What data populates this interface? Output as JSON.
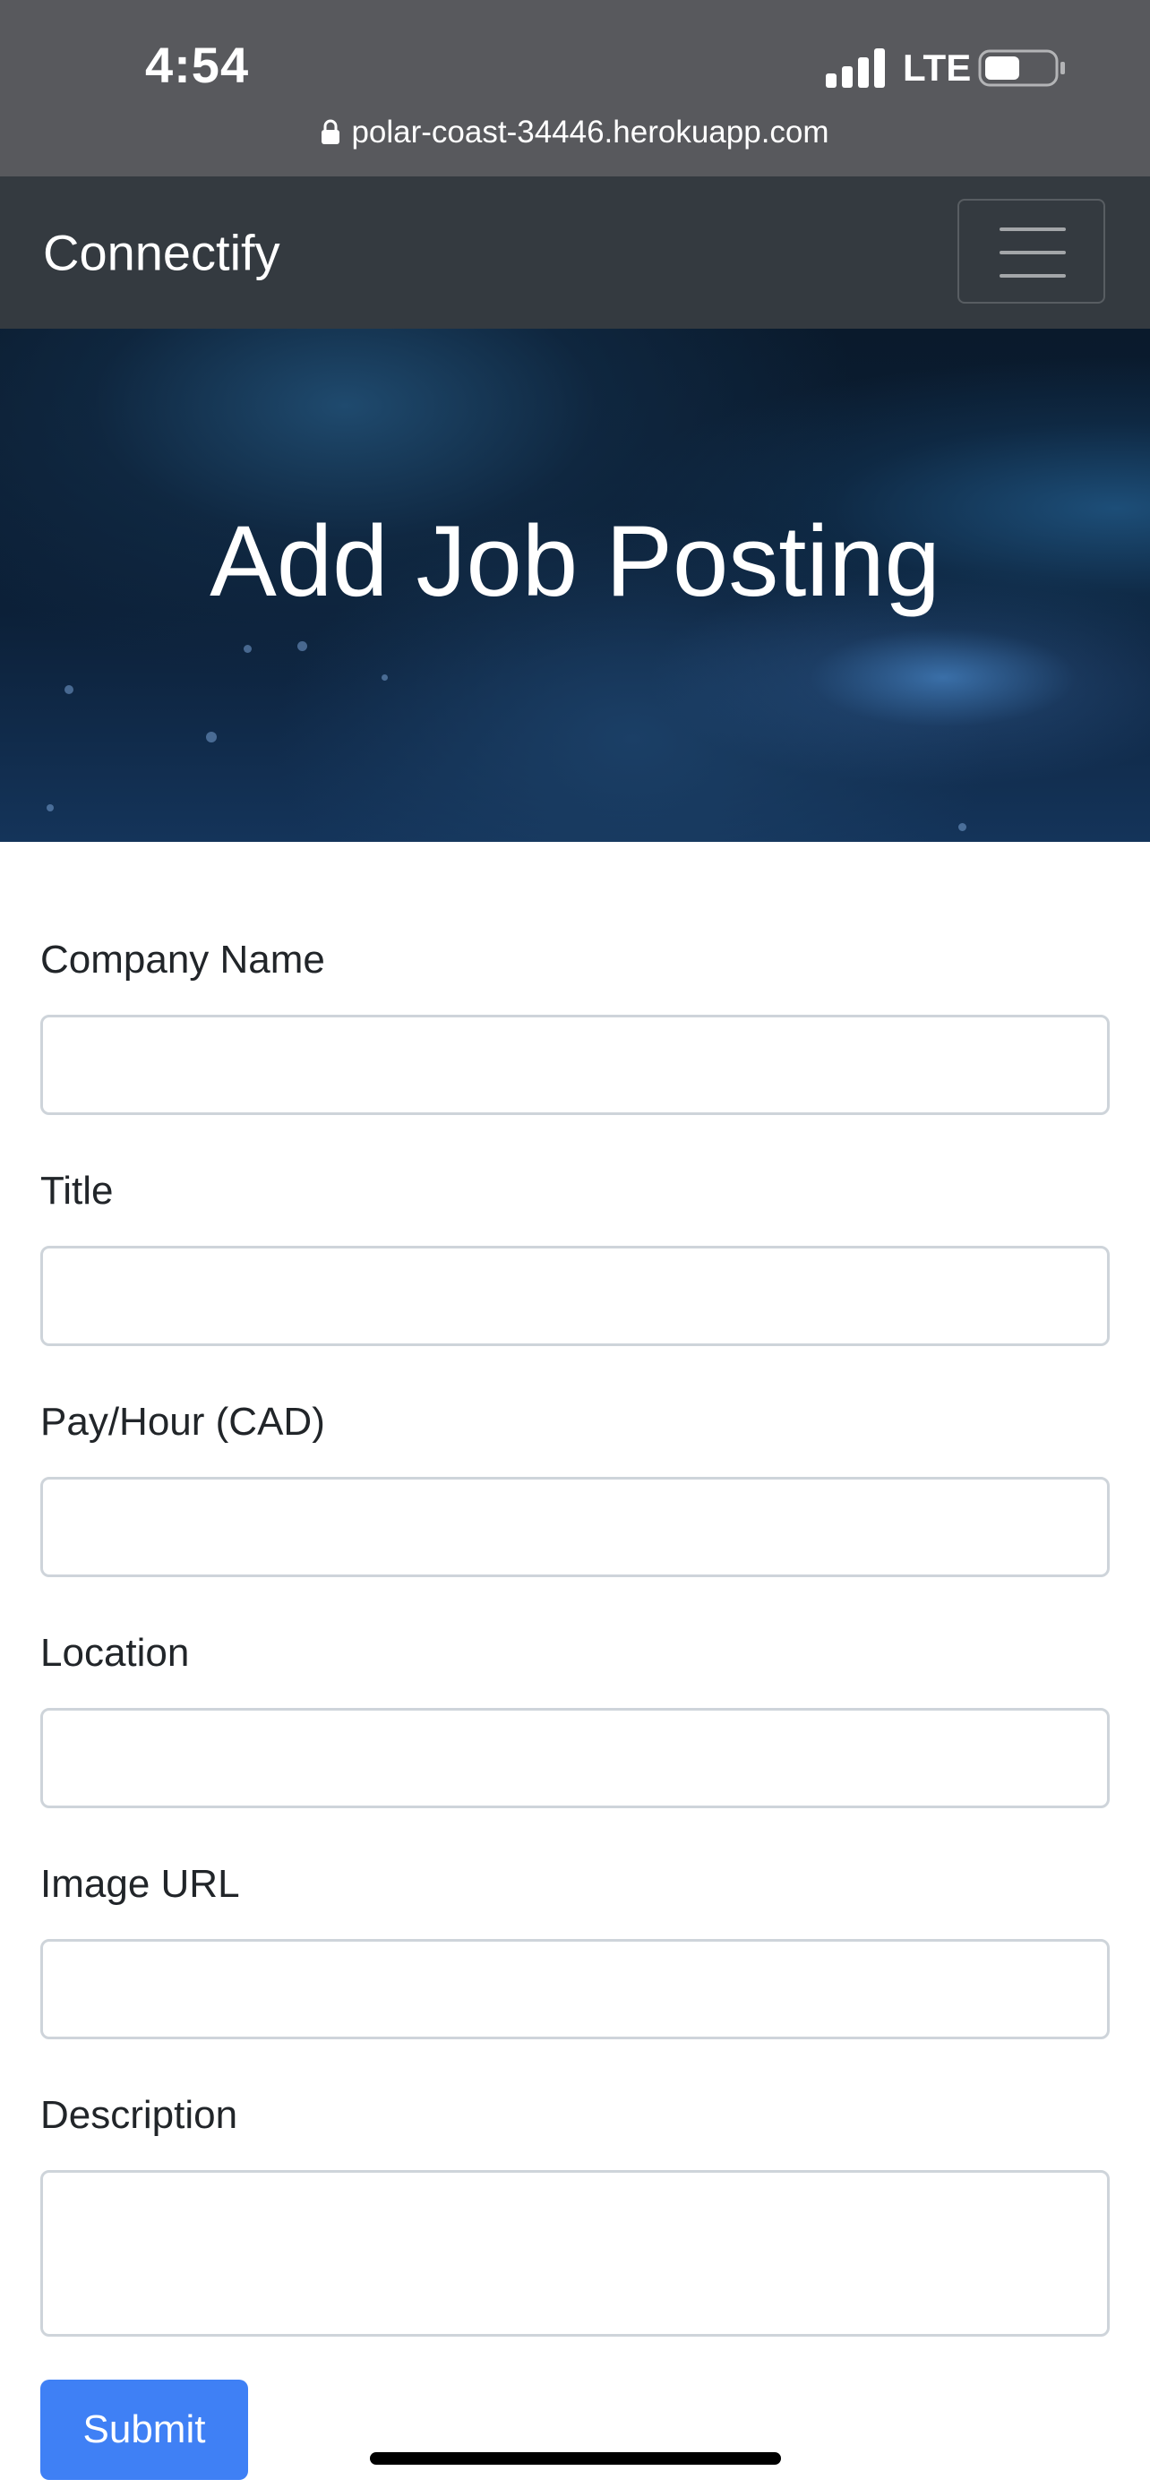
{
  "status_bar": {
    "time": "4:54",
    "network": "LTE",
    "url": "polar-coast-34446.herokuapp.com"
  },
  "navbar": {
    "brand": "Connectify",
    "toggle_icon": "hamburger-menu-icon"
  },
  "hero": {
    "title": "Add Job Posting"
  },
  "form": {
    "fields": [
      {
        "label": "Company Name",
        "value": "",
        "placeholder": ""
      },
      {
        "label": "Title",
        "value": "",
        "placeholder": ""
      },
      {
        "label": "Pay/Hour (CAD)",
        "value": "",
        "placeholder": ""
      },
      {
        "label": "Location",
        "value": "",
        "placeholder": ""
      },
      {
        "label": "Image URL",
        "value": "",
        "placeholder": ""
      },
      {
        "label": "Description",
        "value": "",
        "placeholder": ""
      }
    ],
    "submit_label": "Submit"
  },
  "colors": {
    "status_bar_bg": "#58595d",
    "navbar_bg": "#343a40",
    "primary_button": "#3f80f5",
    "input_border": "#ced4da"
  }
}
